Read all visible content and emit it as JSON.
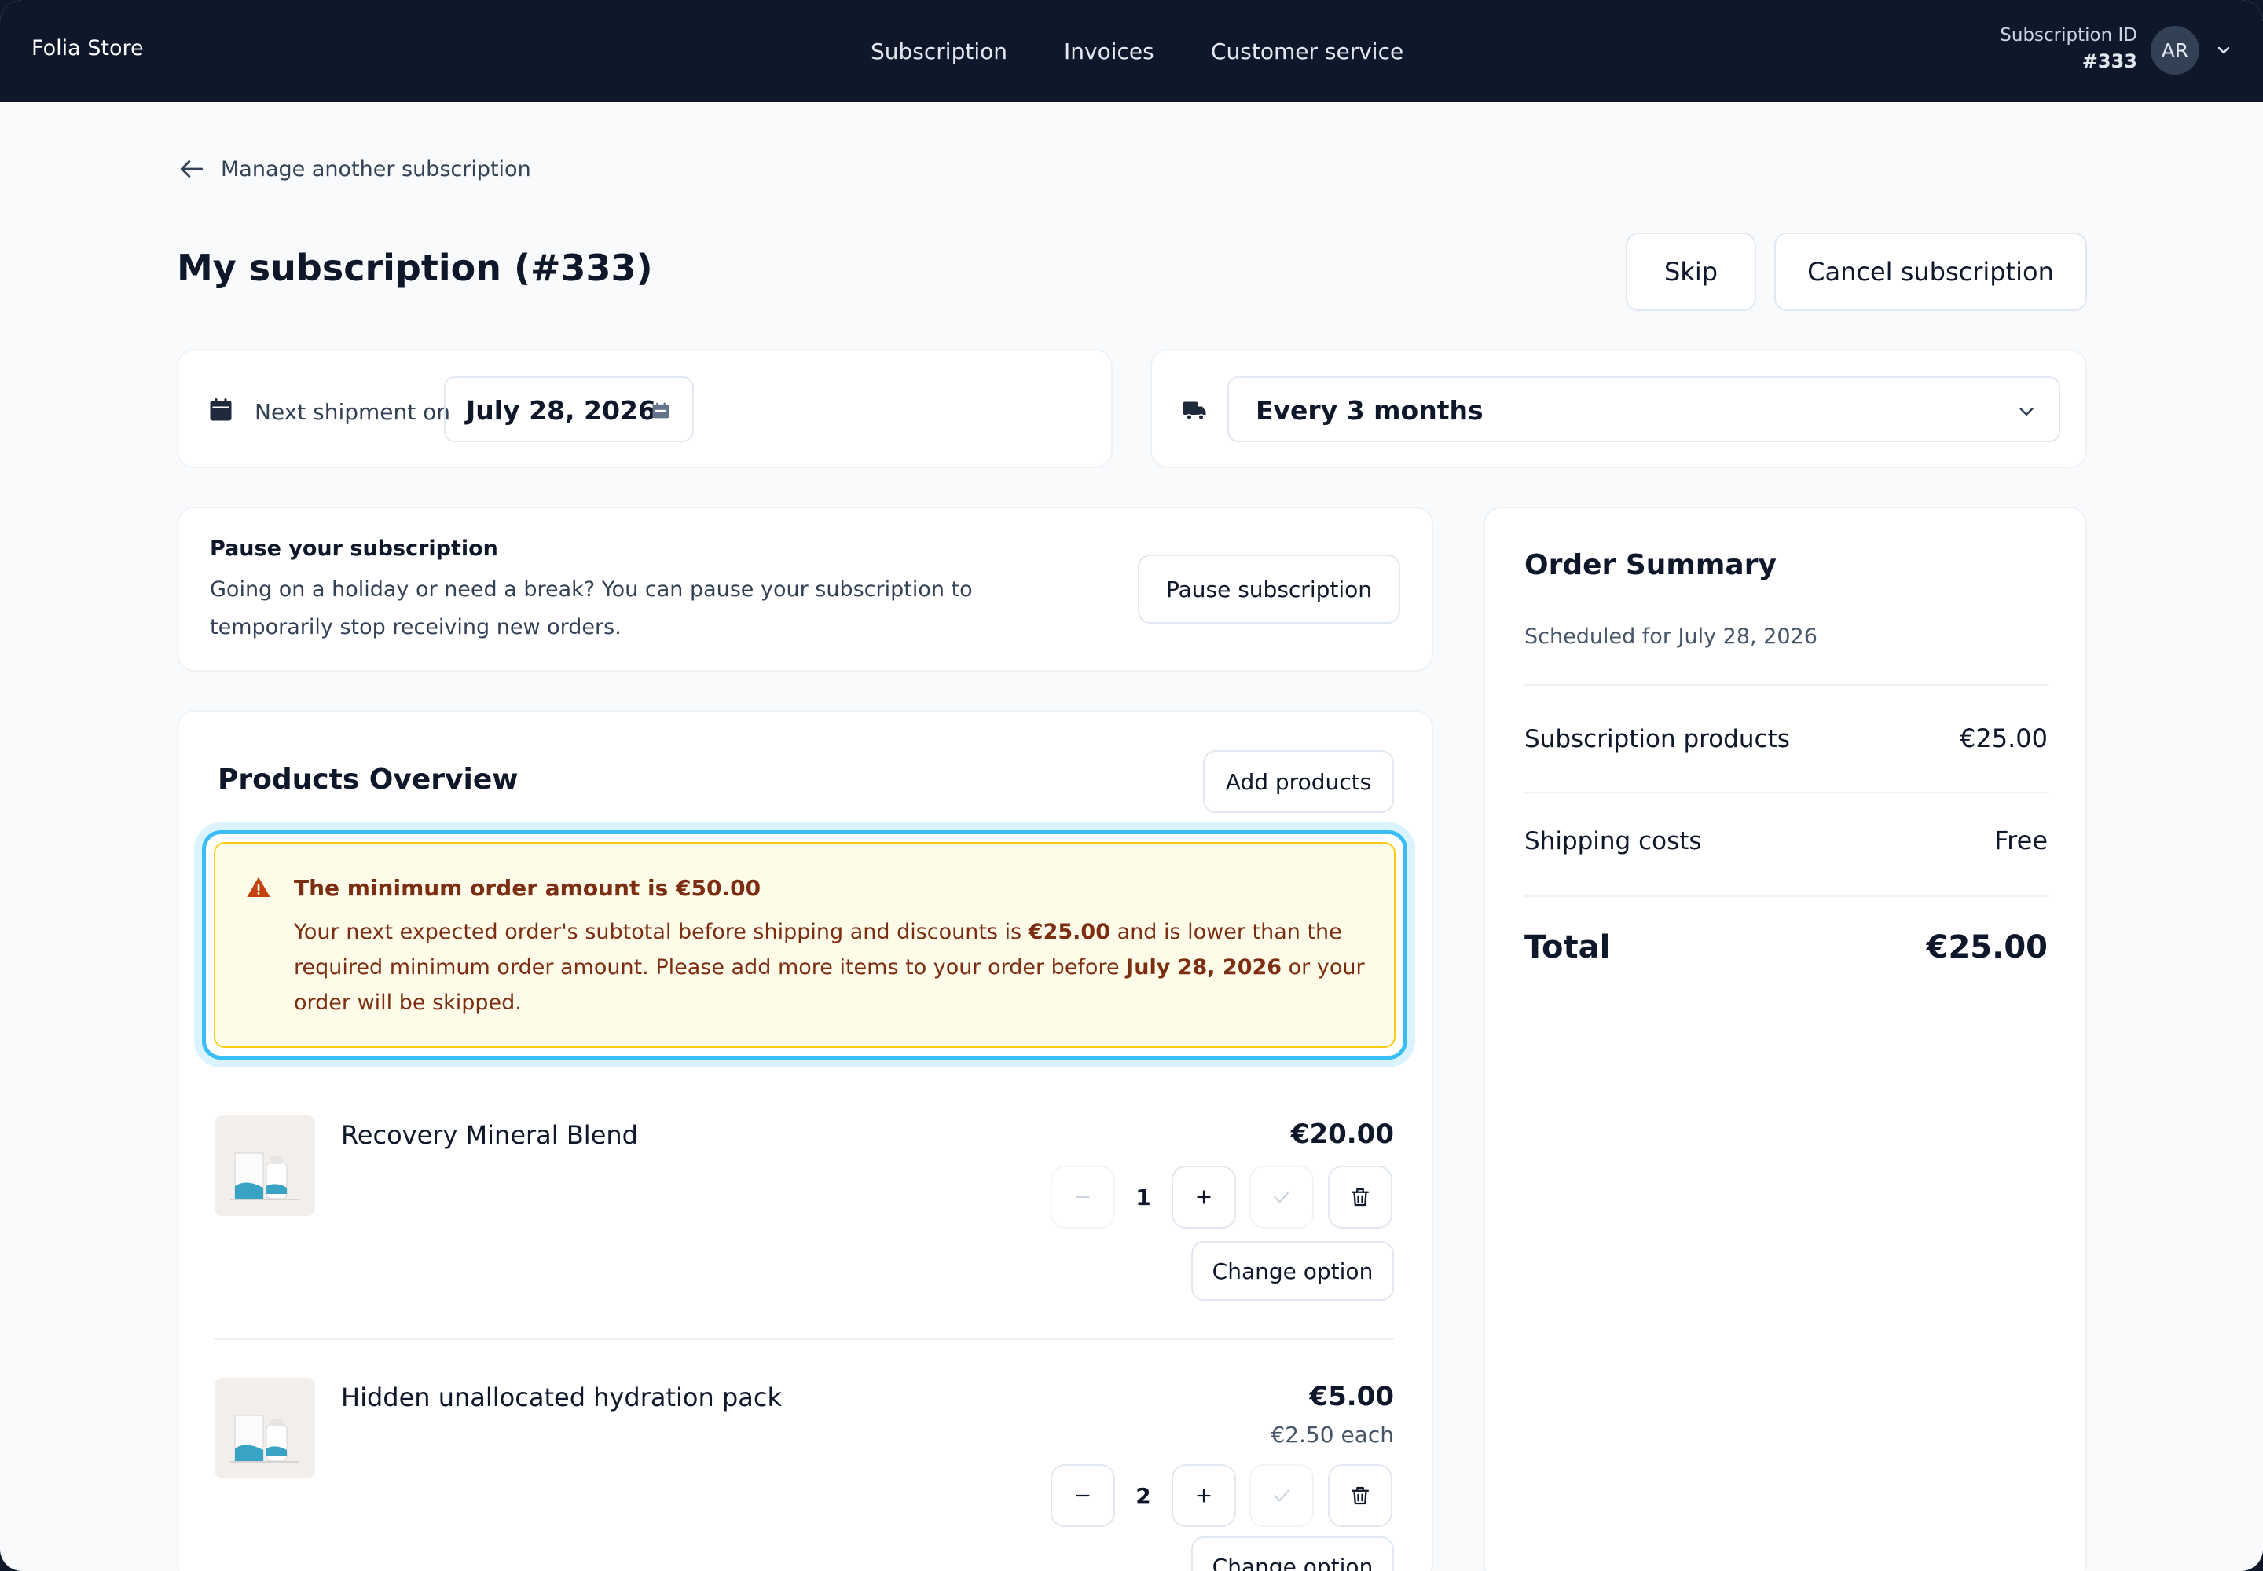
{
  "header": {
    "brand": "Folia Store",
    "nav": [
      "Subscription",
      "Invoices",
      "Customer service"
    ],
    "subscription_id_label": "Subscription ID",
    "subscription_id_value": "#333",
    "avatar_initials": "AR"
  },
  "back_link": "Manage another subscription",
  "page_title": "My subscription (#333)",
  "actions": {
    "skip": "Skip",
    "cancel": "Cancel subscription"
  },
  "shipment": {
    "label": "Next shipment on",
    "date": "July 28, 2026"
  },
  "frequency": {
    "selected": "Every 3 months"
  },
  "pause": {
    "title": "Pause your subscription",
    "description": "Going on a holiday or need a break? You can pause your subscription to temporarily stop receiving new orders.",
    "button": "Pause subscription"
  },
  "products": {
    "title": "Products Overview",
    "add_button": "Add products",
    "alert": {
      "title": "The minimum order amount is €50.00",
      "body_1": "Your next expected order's subtotal before shipping and discounts is ",
      "amount": "€25.00",
      "body_2": " and is lower than the required minimum order amount. Please add more items to your order before ",
      "date": "July 28, 2026",
      "body_3": " or your order will be skipped."
    },
    "items": [
      {
        "name": "Recovery Mineral Blend",
        "price": "€20.00",
        "each": "",
        "qty": "1",
        "change": "Change option"
      },
      {
        "name": "Hidden unallocated hydration pack",
        "price": "€5.00",
        "each": "€2.50 each",
        "qty": "2",
        "change": "Change option"
      }
    ]
  },
  "summary": {
    "title": "Order Summary",
    "scheduled": "Scheduled for July 28, 2026",
    "rows": [
      {
        "label": "Subscription products",
        "value": "€25.00"
      },
      {
        "label": "Shipping costs",
        "value": "Free"
      }
    ],
    "total_label": "Total",
    "total_value": "€25.00"
  },
  "colors": {
    "header_bg": "#0f172a",
    "alert_bg": "#fefbe8",
    "alert_border": "#facc15",
    "focus_ring": "#38bdf8",
    "alert_text": "#7c2d12"
  }
}
